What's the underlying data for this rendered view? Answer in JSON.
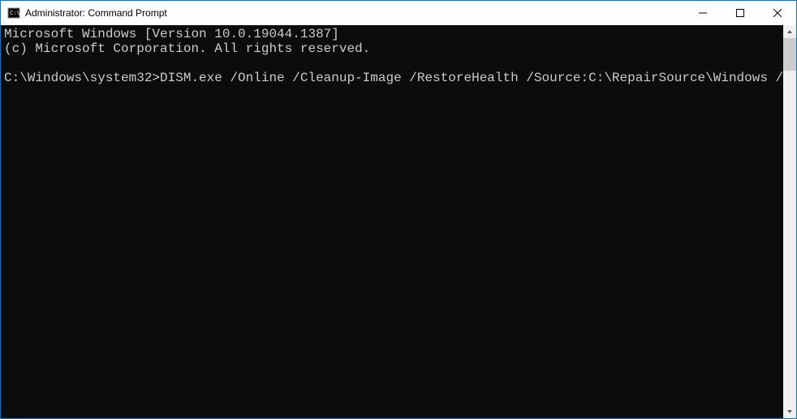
{
  "window": {
    "title": "Administrator: Command Prompt"
  },
  "console": {
    "line1": "Microsoft Windows [Version 10.0.19044.1387]",
    "line2": "(c) Microsoft Corporation. All rights reserved.",
    "blank": "",
    "prompt": "C:\\Windows\\system32>",
    "command": "DISM.exe /Online /Cleanup-Image /RestoreHealth /Source:C:\\RepairSource\\Windows /LimitAccess"
  }
}
